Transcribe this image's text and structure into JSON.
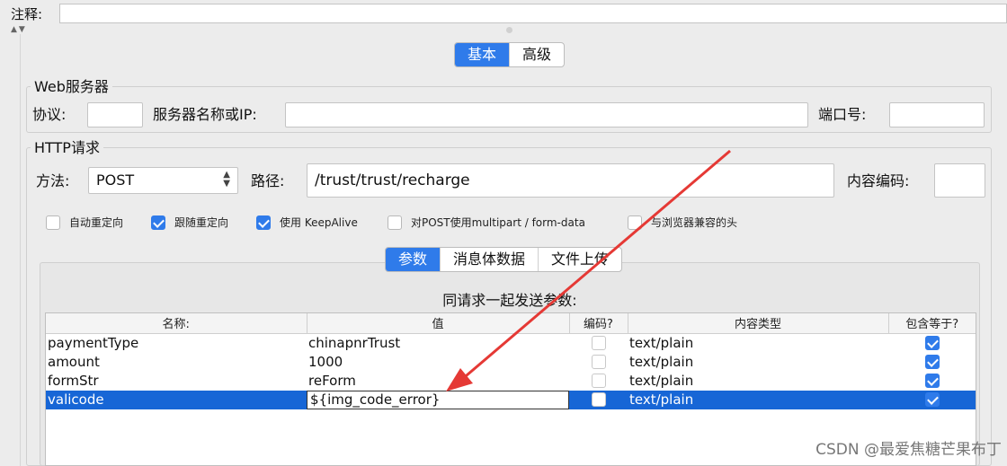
{
  "comment": {
    "label": "注释:"
  },
  "main_tabs": [
    {
      "label": "基本",
      "active": true
    },
    {
      "label": "高级",
      "active": false
    }
  ],
  "web_server": {
    "title": "Web服务器",
    "protocol_label": "协议:",
    "protocol_value": "",
    "server_label": "服务器名称或IP:",
    "server_value": "",
    "port_label": "端口号:",
    "port_value": ""
  },
  "http_request": {
    "title": "HTTP请求",
    "method_label": "方法:",
    "method_value": "POST",
    "path_label": "路径:",
    "path_value": "/trust/trust/recharge",
    "encoding_label": "内容编码:",
    "encoding_value": ""
  },
  "options": [
    {
      "label": "自动重定向",
      "checked": false
    },
    {
      "label": "跟随重定向",
      "checked": true
    },
    {
      "label": "使用 KeepAlive",
      "checked": true
    },
    {
      "label": "对POST使用multipart / form-data",
      "checked": false
    },
    {
      "label": "与浏览器兼容的头",
      "checked": false
    }
  ],
  "param_tabs": [
    {
      "label": "参数",
      "active": true
    },
    {
      "label": "消息体数据",
      "active": false
    },
    {
      "label": "文件上传",
      "active": false
    }
  ],
  "params": {
    "title": "同请求一起发送参数:",
    "headers": [
      "名称:",
      "值",
      "编码?",
      "内容类型",
      "包含等于?"
    ],
    "rows": [
      {
        "name": "paymentType",
        "value": "chinapnrTrust",
        "encode": false,
        "content_type": "text/plain",
        "include_equals": true,
        "selected": false
      },
      {
        "name": "amount",
        "value": "1000",
        "encode": false,
        "content_type": "text/plain",
        "include_equals": true,
        "selected": false
      },
      {
        "name": "formStr",
        "value": "reForm",
        "encode": false,
        "content_type": "text/plain",
        "include_equals": true,
        "selected": false
      },
      {
        "name": "valicode",
        "value": "${img_code_error}",
        "encode": false,
        "content_type": "text/plain",
        "include_equals": true,
        "selected": true
      }
    ]
  },
  "annotation": {
    "color": "#e53935"
  },
  "watermark": {
    "text": "CSDN @最爱焦糖芒果布丁"
  }
}
